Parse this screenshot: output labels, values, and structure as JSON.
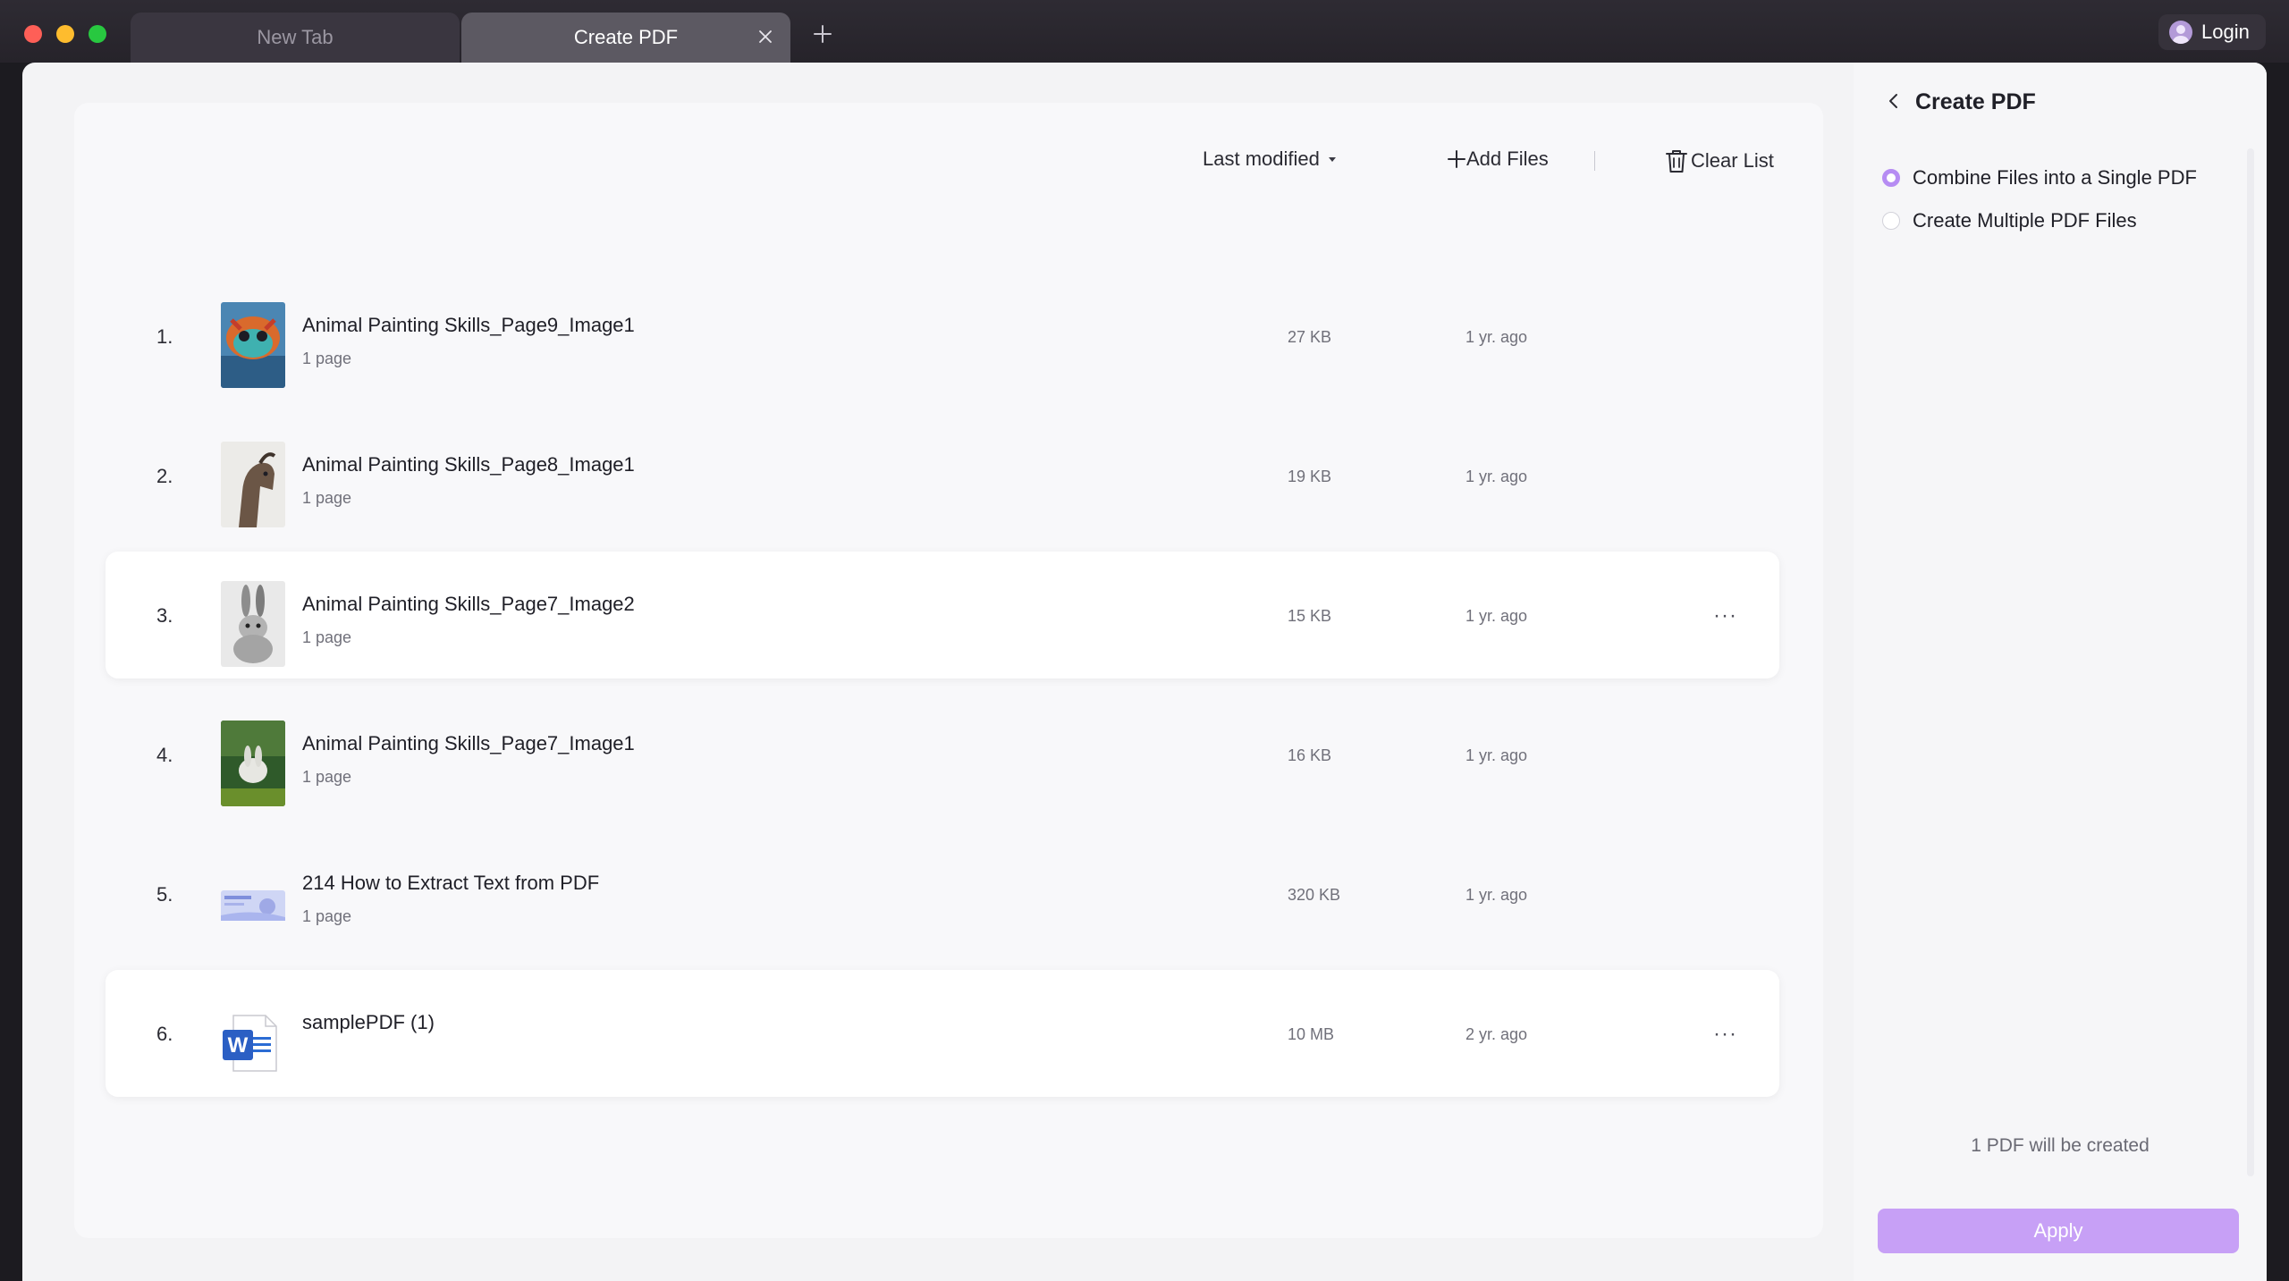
{
  "browser": {
    "tabs": [
      {
        "label": "New Tab"
      },
      {
        "label": "Create PDF"
      }
    ],
    "login_label": "Login"
  },
  "toolbar": {
    "sort_label": "Last modified",
    "add_files_label": "Add Files",
    "clear_list_label": "Clear List"
  },
  "files": [
    {
      "index": "1.",
      "name": "Animal Painting Skills_Page9_Image1",
      "pages": "1 page",
      "size": "27 KB",
      "modified": "1 yr. ago"
    },
    {
      "index": "2.",
      "name": "Animal Painting Skills_Page8_Image1",
      "pages": "1 page",
      "size": "19 KB",
      "modified": "1 yr. ago"
    },
    {
      "index": "3.",
      "name": "Animal Painting Skills_Page7_Image2",
      "pages": "1 page",
      "size": "15 KB",
      "modified": "1 yr. ago",
      "more": "···"
    },
    {
      "index": "4.",
      "name": "Animal Painting Skills_Page7_Image1",
      "pages": "1 page",
      "size": "16 KB",
      "modified": "1 yr. ago"
    },
    {
      "index": "5.",
      "name": "214 How to Extract Text from PDF",
      "pages": "1 page",
      "size": "320 KB",
      "modified": "1 yr. ago"
    },
    {
      "index": "6.",
      "name": "samplePDF (1)",
      "pages": "",
      "size": "10 MB",
      "modified": "2 yr. ago",
      "more": "···"
    }
  ],
  "panel": {
    "title": "Create PDF",
    "options": [
      {
        "label": "Combine Files into a Single PDF",
        "selected": true
      },
      {
        "label": "Create Multiple PDF Files",
        "selected": false
      }
    ],
    "summary": "1 PDF will be created",
    "apply_label": "Apply"
  },
  "colors": {
    "accent": "#b68cf3",
    "apply_button": "#c7a0f6",
    "close_red": "#fe5f57",
    "minimize_yellow": "#febc2e",
    "zoom_green": "#28c840"
  }
}
